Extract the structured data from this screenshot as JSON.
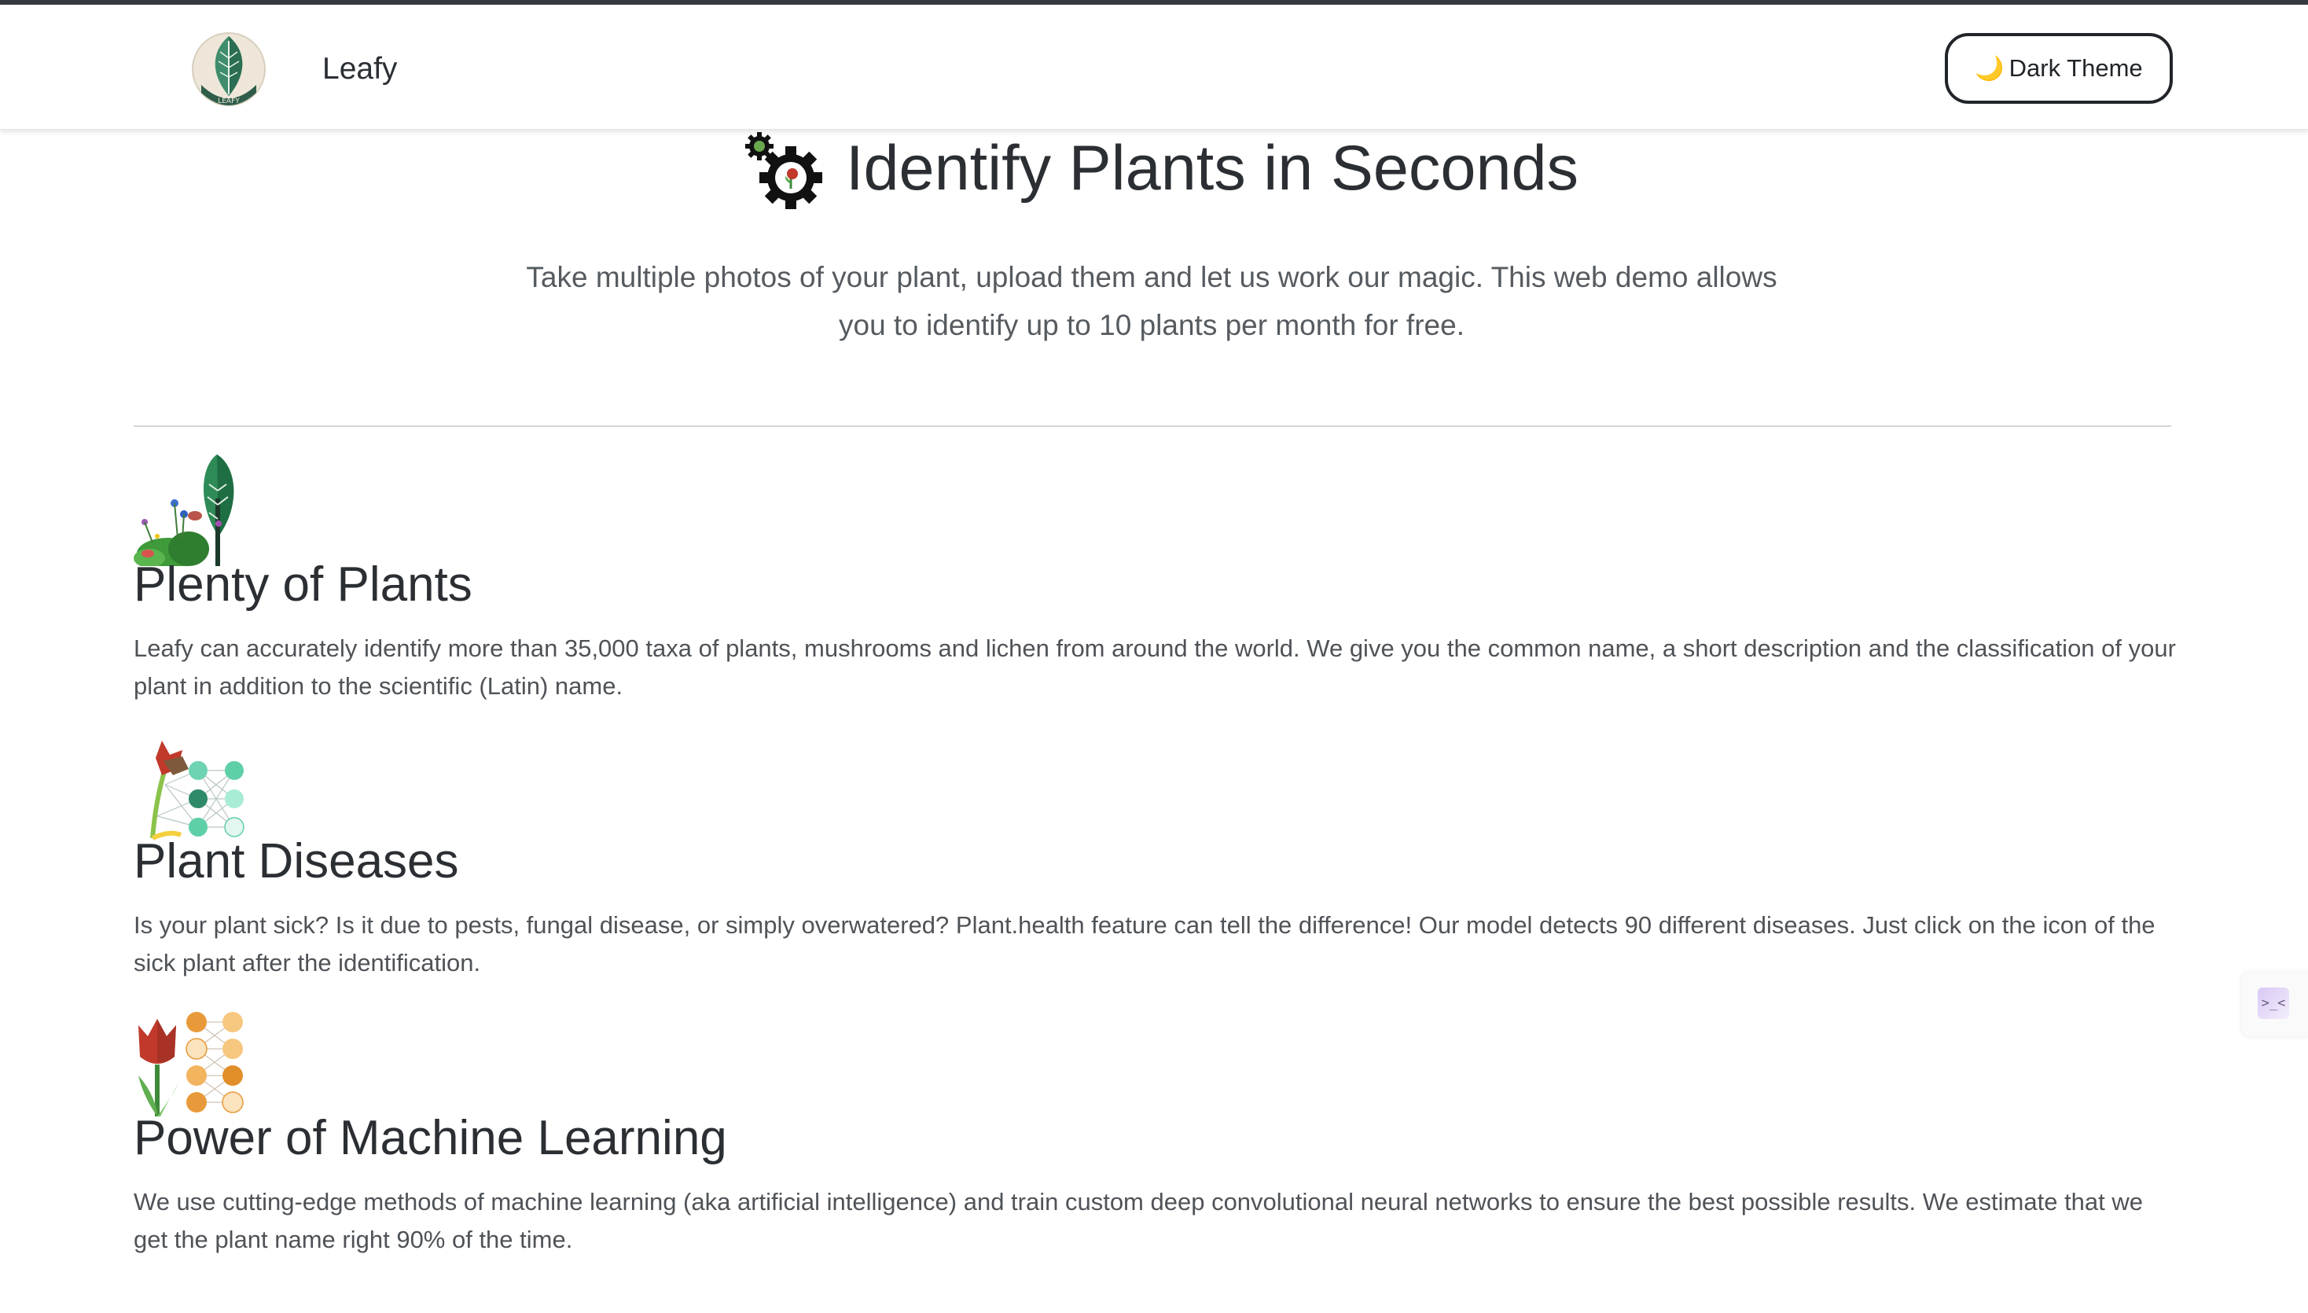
{
  "navbar": {
    "brand_name": "Leafy",
    "logo_text": "LEAFY",
    "theme_button_icon": "🌙",
    "theme_button_label": "Dark Theme"
  },
  "hero": {
    "icon": "gear-plant-icon",
    "title": "Identify Plants in Seconds",
    "subtitle": "Take multiple photos of your plant, upload them and let us work our magic. This web demo allows you to identify up to 10 plants per month for free."
  },
  "features": [
    {
      "icon": "plants-trees-icon",
      "title": "Plenty of Plants",
      "text": "Leafy can accurately identify more than 35,000 taxa of plants, mushrooms and lichen from around the world. We give you the common name, a short description and the classification of your plant in addition to the scientific (Latin) name."
    },
    {
      "icon": "sick-plant-network-icon",
      "title": "Plant Diseases",
      "text": "Is your plant sick? Is it due to pests, fungal disease, or simply overwatered? Plant.health feature can tell the difference! Our model detects 90 different diseases. Just click on the icon of the sick plant after the identification."
    },
    {
      "icon": "tulip-network-icon",
      "title": "Power of Machine Learning",
      "text": "We use cutting-edge methods of machine learning (aka artificial intelligence) and train custom deep convolutional neural networks to ensure the best possible results. We estimate that we get the plant name right 90% of the time."
    }
  ],
  "side_widget": {
    "icon": "assistant-icon",
    "glyph": ">_<"
  },
  "colors": {
    "top_strip": "#343a40",
    "text_dark": "#2b2f33",
    "text_muted": "#565b60",
    "leaf_green": "#2e7d4f",
    "node_teal": "#5fcfa7",
    "node_orange": "#e89a3a"
  }
}
